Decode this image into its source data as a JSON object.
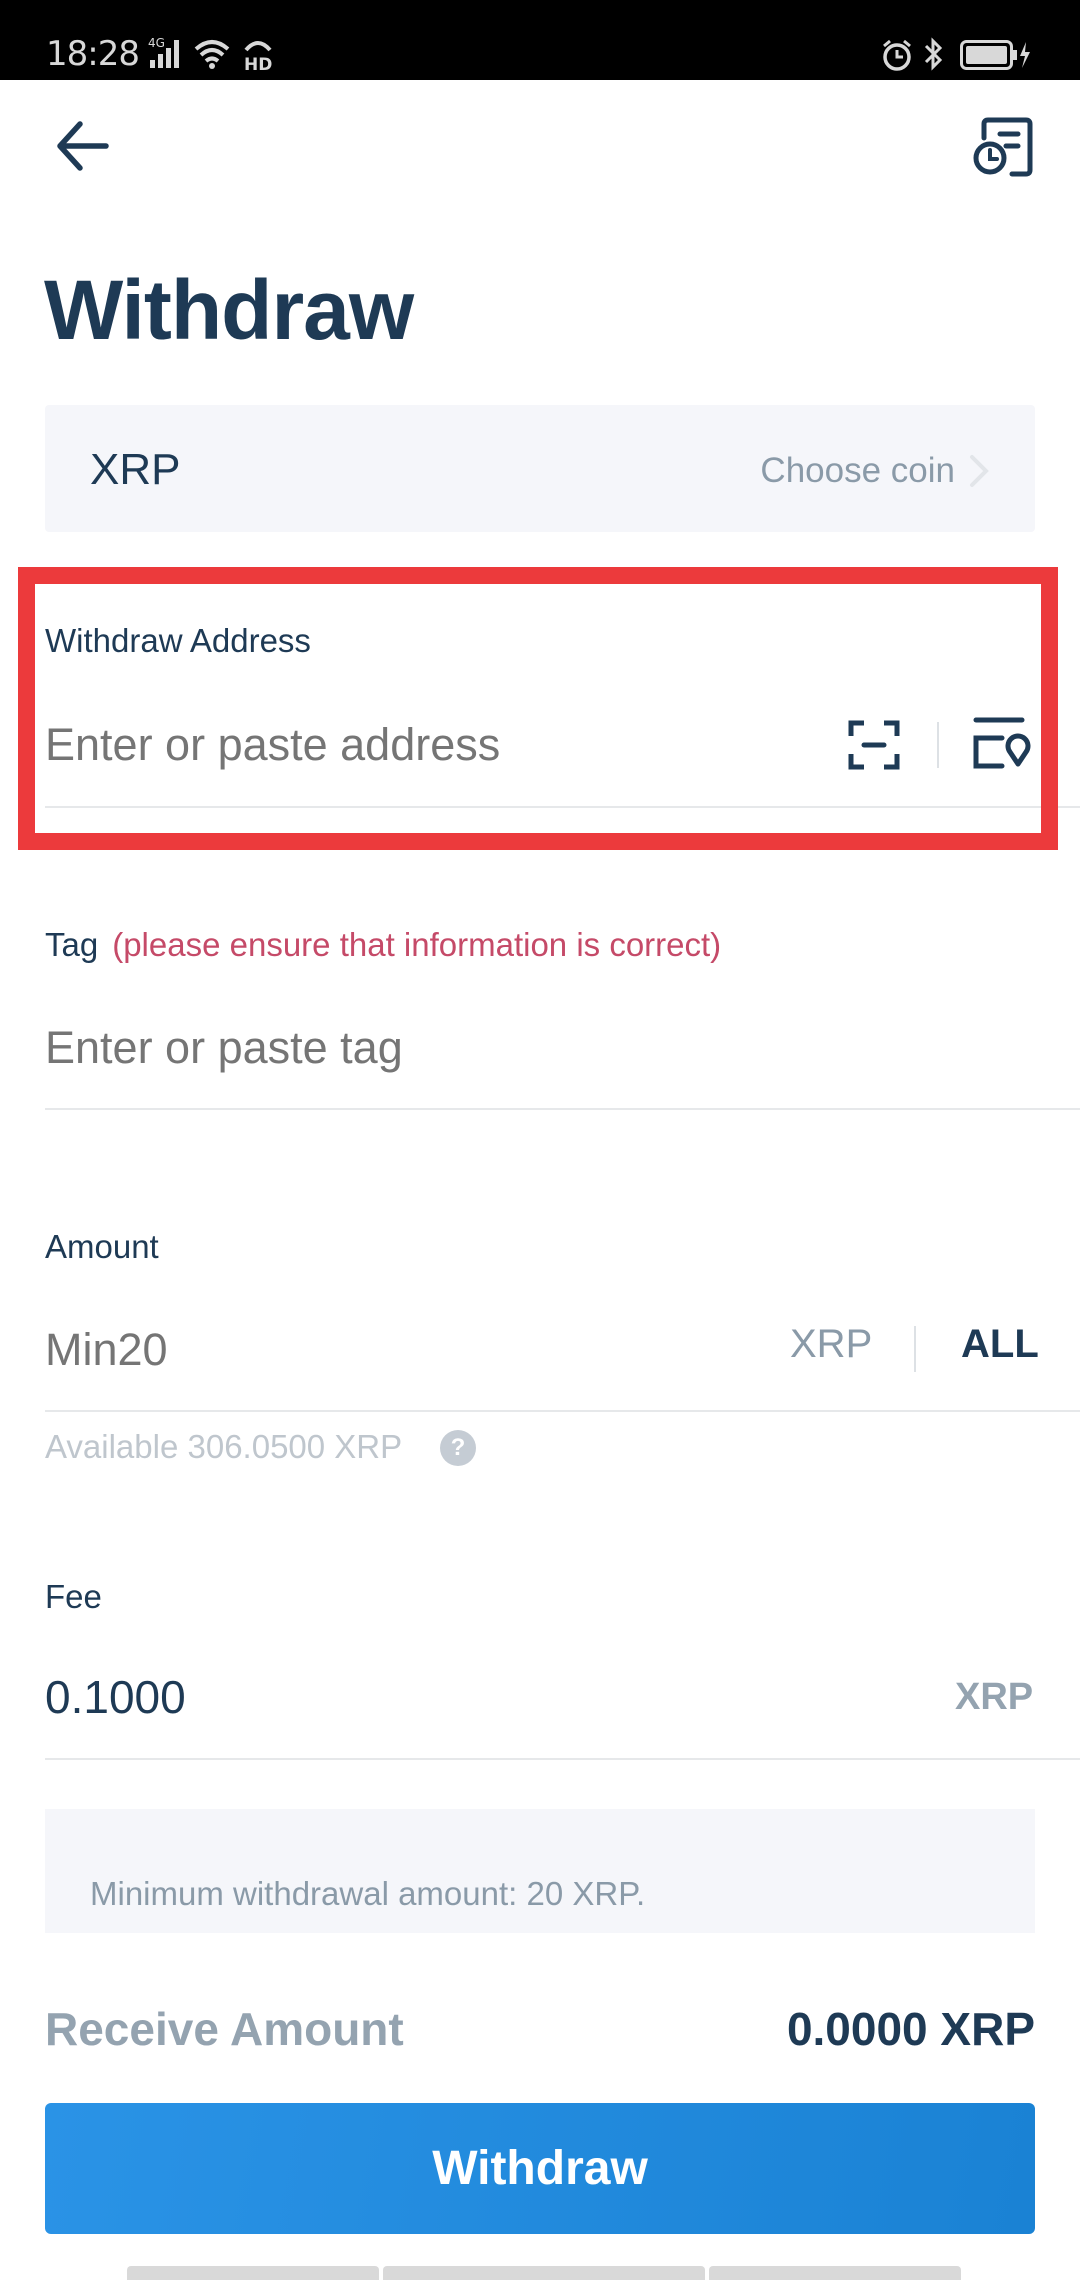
{
  "status_bar": {
    "time": "18:28",
    "network": "4G",
    "hd_label": "HD",
    "icons": [
      "signal-icon",
      "wifi-icon",
      "hd-icon",
      "alarm-icon",
      "bluetooth-icon",
      "battery-icon",
      "charging-icon"
    ]
  },
  "header": {
    "back_icon": "arrow-left-icon",
    "history_icon": "withdraw-history-icon",
    "title": "Withdraw"
  },
  "coin_selector": {
    "selected_coin": "XRP",
    "action_label": "Choose coin",
    "chevron_icon": "chevron-right-icon"
  },
  "address_field": {
    "label": "Withdraw Address",
    "value": "",
    "placeholder": "Enter or paste address",
    "scan_icon": "scan-qr-icon",
    "address_book_icon": "address-book-icon",
    "highlighted": true,
    "highlight_color": "#ec3a3c"
  },
  "tag_field": {
    "label": "Tag",
    "warning": "(please ensure that information is correct)",
    "value": "",
    "placeholder": "Enter or paste tag"
  },
  "amount_field": {
    "label": "Amount",
    "value": "",
    "placeholder": "Min20",
    "unit": "XRP",
    "all_label": "ALL",
    "available_text": "Available 306.0500 XRP",
    "help_icon": "question-icon",
    "help_glyph": "?"
  },
  "fee_field": {
    "label": "Fee",
    "value": "0.1000",
    "unit": "XRP"
  },
  "info": {
    "text": "Minimum withdrawal amount: 20 XRP."
  },
  "receive": {
    "label": "Receive Amount",
    "value": "0.0000 XRP"
  },
  "submit": {
    "label": "Withdraw"
  },
  "colors": {
    "primary_text": "#1e3a55",
    "accent_blue": "#2a93e6",
    "warning_red": "#c54a68",
    "muted": "#8a9aa8",
    "panel_bg": "#f5f6fa"
  }
}
